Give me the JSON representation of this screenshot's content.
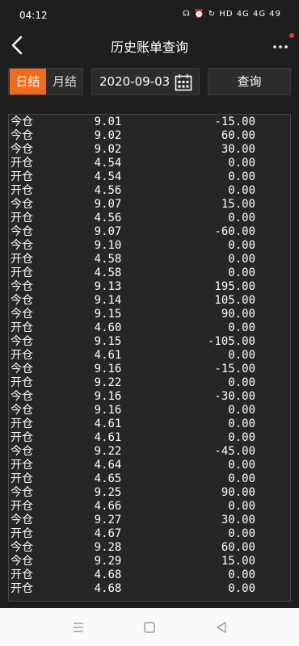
{
  "status": {
    "time": "04:12",
    "icons": "☊ ⏰ ↻ HD 4G 4G 49"
  },
  "header": {
    "title": "历史账单查询"
  },
  "toolbar": {
    "tab_day": "日结",
    "tab_month": "月结",
    "date_value": "2020-09-03",
    "query_label": "查询"
  },
  "records": [
    [
      "今仓",
      "9.01",
      "-15.00"
    ],
    [
      "今仓",
      "9.02",
      "60.00"
    ],
    [
      "今仓",
      "9.02",
      "30.00"
    ],
    [
      "开仓",
      "4.54",
      "0.00"
    ],
    [
      "开仓",
      "4.54",
      "0.00"
    ],
    [
      "开仓",
      "4.56",
      "0.00"
    ],
    [
      "今仓",
      "9.07",
      "15.00"
    ],
    [
      "开仓",
      "4.56",
      "0.00"
    ],
    [
      "今仓",
      "9.07",
      "-60.00"
    ],
    [
      "今仓",
      "9.10",
      "0.00"
    ],
    [
      "开仓",
      "4.58",
      "0.00"
    ],
    [
      "开仓",
      "4.58",
      "0.00"
    ],
    [
      "今仓",
      "9.13",
      "195.00"
    ],
    [
      "今仓",
      "9.14",
      "105.00"
    ],
    [
      "今仓",
      "9.15",
      "90.00"
    ],
    [
      "开仓",
      "4.60",
      "0.00"
    ],
    [
      "今仓",
      "9.15",
      "-105.00"
    ],
    [
      "开仓",
      "4.61",
      "0.00"
    ],
    [
      "今仓",
      "9.16",
      "-15.00"
    ],
    [
      "开仓",
      "9.22",
      "0.00"
    ],
    [
      "今仓",
      "9.16",
      "-30.00"
    ],
    [
      "今仓",
      "9.16",
      "0.00"
    ],
    [
      "开仓",
      "4.61",
      "0.00"
    ],
    [
      "开仓",
      "4.61",
      "0.00"
    ],
    [
      "今仓",
      "9.22",
      "-45.00"
    ],
    [
      "开仓",
      "4.64",
      "0.00"
    ],
    [
      "开仓",
      "4.65",
      "0.00"
    ],
    [
      "今仓",
      "9.25",
      "90.00"
    ],
    [
      "开仓",
      "4.66",
      "0.00"
    ],
    [
      "今仓",
      "9.27",
      "30.00"
    ],
    [
      "开仓",
      "4.67",
      "0.00"
    ],
    [
      "今仓",
      "9.28",
      "60.00"
    ],
    [
      "今仓",
      "9.29",
      "15.00"
    ],
    [
      "开仓",
      "4.68",
      "0.00"
    ],
    [
      "开仓",
      "4.68",
      "0.00"
    ]
  ],
  "colors": {
    "accent": "#f26a1b",
    "background": "#1e1e1e",
    "notification_dot": "#e53935"
  },
  "icons": {
    "back": "back-arrow-icon",
    "more": "more-dots-icon",
    "calendar": "calendar-icon",
    "nav_menu": "menu-icon",
    "nav_home": "home-square-icon",
    "nav_back": "back-triangle-icon"
  }
}
